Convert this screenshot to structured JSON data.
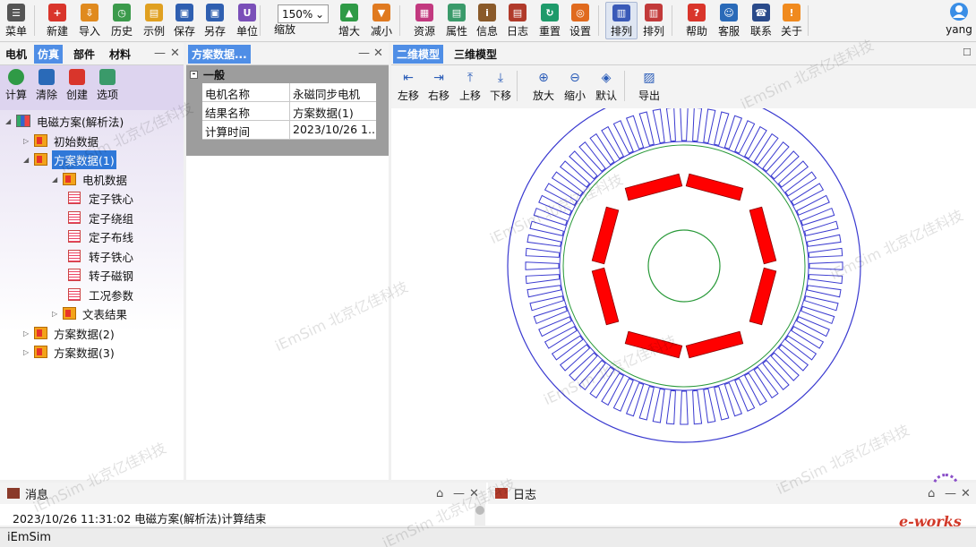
{
  "toolbar": {
    "items": [
      {
        "label": "菜单",
        "icon": "menu-icon",
        "color": "#555555"
      },
      {
        "label": "新建",
        "icon": "new-icon",
        "color": "#d9352b"
      },
      {
        "label": "导入",
        "icon": "import-icon",
        "color": "#e08a1e"
      },
      {
        "label": "历史",
        "icon": "history-icon",
        "color": "#3b9a4b"
      },
      {
        "label": "示例",
        "icon": "example-icon",
        "color": "#e0a020"
      },
      {
        "label": "保存",
        "icon": "save-icon",
        "color": "#2f5fb0"
      },
      {
        "label": "另存",
        "icon": "save-as-icon",
        "color": "#2f5fb0"
      },
      {
        "label": "单位",
        "icon": "unit-icon",
        "color": "#7a4fb8"
      },
      {
        "label": "缩放",
        "icon": "zoom-icon",
        "color": "#555555"
      },
      {
        "label": "增大",
        "icon": "increase-icon",
        "color": "#2f9a46"
      },
      {
        "label": "减小",
        "icon": "decrease-icon",
        "color": "#e07a20"
      },
      {
        "label": "资源",
        "icon": "resource-icon",
        "color": "#c2397f"
      },
      {
        "label": "属性",
        "icon": "property-icon",
        "color": "#3a9a6a"
      },
      {
        "label": "信息",
        "icon": "info-icon",
        "color": "#8a5a2a"
      },
      {
        "label": "日志",
        "icon": "log-icon",
        "color": "#b03a2a"
      },
      {
        "label": "重置",
        "icon": "reset-icon",
        "color": "#1e9a6a"
      },
      {
        "label": "设置",
        "icon": "settings-icon",
        "color": "#e06a1e"
      },
      {
        "label": "排列",
        "icon": "arrange-icon",
        "color": "#3a5ab8"
      },
      {
        "label": "排列",
        "icon": "arrange-alt-icon",
        "color": "#c23a3a"
      },
      {
        "label": "帮助",
        "icon": "help-icon",
        "color": "#d9352b"
      },
      {
        "label": "客服",
        "icon": "service-icon",
        "color": "#2a6ab8"
      },
      {
        "label": "联系",
        "icon": "contact-icon",
        "color": "#2a4a8a"
      },
      {
        "label": "关于",
        "icon": "about-icon",
        "color": "#f08a1e"
      }
    ],
    "zoom_value": "150%",
    "user_name": "yang"
  },
  "left": {
    "tabs": [
      "电机",
      "仿真",
      "部件",
      "材料"
    ],
    "tools": [
      {
        "label": "计算",
        "icon": "run-icon",
        "color": "#2f9a46"
      },
      {
        "label": "清除",
        "icon": "clear-icon",
        "color": "#2a6ab8"
      },
      {
        "label": "创建",
        "icon": "create-icon",
        "color": "#d9352b"
      },
      {
        "label": "选项",
        "icon": "options-icon",
        "color": "#3a9a6a"
      }
    ],
    "tree": {
      "root": "电磁方案(解析法)",
      "initial": "初始数据",
      "scheme1": "方案数据(1)",
      "motor_data": "电机数据",
      "children": [
        "定子铁心",
        "定子绕组",
        "定子布线",
        "转子铁心",
        "转子磁钢",
        "工况参数"
      ],
      "results": "文表结果",
      "scheme2": "方案数据(2)",
      "scheme3": "方案数据(3)"
    }
  },
  "middle": {
    "title": "方案数据...",
    "group": "一般",
    "rows": [
      {
        "key": "电机名称",
        "value": "永磁同步电机"
      },
      {
        "key": "结果名称",
        "value": "方案数据(1)"
      },
      {
        "key": "计算时间",
        "value": "2023/10/26 1..."
      }
    ]
  },
  "main": {
    "tabs": [
      "二维模型",
      "三维模型"
    ],
    "tools": [
      "左移",
      "右移",
      "上移",
      "下移",
      "放大",
      "缩小",
      "默认",
      "导出"
    ],
    "logo_text": "iEmSim",
    "model": {
      "stator_slots": 72,
      "magnet_poles": 8
    }
  },
  "bottom": {
    "messages_title": "消息",
    "message": "2023/10/26 11:31:02  电磁方案(解析法)计算结束",
    "log_title": "日志",
    "brand": "e-works"
  },
  "status": "iEmSim",
  "watermark": "iEmSim 北京亿佳科技"
}
